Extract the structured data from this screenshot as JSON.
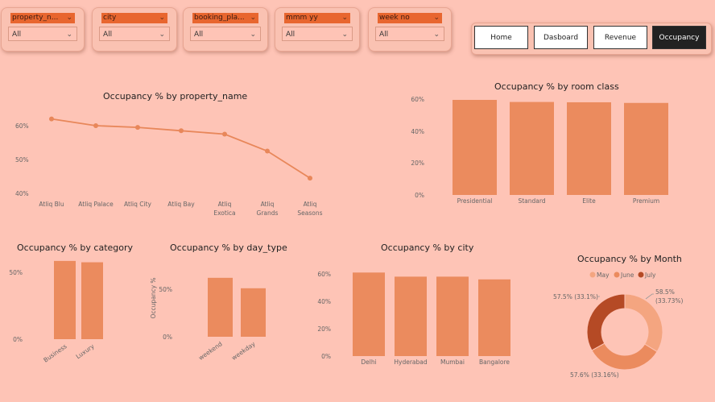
{
  "slicers": [
    {
      "label": "property_n...",
      "value": "All"
    },
    {
      "label": "city",
      "value": "All"
    },
    {
      "label": "booking_pla...",
      "value": "All"
    },
    {
      "label": "mmm yy",
      "value": "All"
    },
    {
      "label": "week no",
      "value": "All"
    }
  ],
  "nav": {
    "home": "Home",
    "dashboard": "Dasboard",
    "revenue": "Revenue",
    "occupancy": "Occupancy"
  },
  "colors": {
    "background": "#FEC4B6",
    "bar": "#EB8B5E",
    "line": "#E8875A",
    "slicer_header": "#E8662F",
    "may": "#F4A580",
    "june": "#EB8B5E",
    "july": "#B54A25"
  },
  "chart_data": [
    {
      "type": "line",
      "title": "Occupancy % by property_name",
      "categories": [
        "Atliq Blu",
        "Atliq Palace",
        "Atliq City",
        "Atliq Bay",
        "Atliq Exotica",
        "Atliq Grands",
        "Atliq Seasons"
      ],
      "values": [
        62,
        60,
        59.5,
        58.5,
        57.5,
        52.5,
        44.5
      ],
      "yticks": [
        "40%",
        "50%",
        "60%"
      ],
      "ylim": [
        40,
        65
      ]
    },
    {
      "type": "bar",
      "title": "Occupancy % by room class",
      "categories": [
        "Presidential",
        "Standard",
        "Elite",
        "Premium"
      ],
      "values": [
        59.5,
        58.2,
        58,
        57.6
      ],
      "yticks": [
        "0%",
        "20%",
        "40%",
        "60%"
      ],
      "ylim": [
        0,
        60
      ]
    },
    {
      "type": "bar",
      "title": "Occupancy % by category",
      "categories": [
        "Business",
        "Luxury"
      ],
      "values": [
        58.5,
        57.5
      ],
      "yticks": [
        "0%",
        "50%"
      ],
      "ylim": [
        0,
        50
      ]
    },
    {
      "type": "bar",
      "title": "Occupancy % by day_type",
      "ylabel": "Occupancy %",
      "categories": [
        "weekend",
        "weekday"
      ],
      "values": [
        62,
        51
      ],
      "yticks": [
        "0%",
        "50%"
      ],
      "ylim": [
        0,
        50
      ]
    },
    {
      "type": "bar",
      "title": "Occupancy % by city",
      "categories": [
        "Delhi",
        "Hyderabad",
        "Mumbai",
        "Bangalore"
      ],
      "values": [
        61,
        58,
        58,
        56
      ],
      "yticks": [
        "0%",
        "20%",
        "40%",
        "60%"
      ],
      "ylim": [
        0,
        60
      ]
    },
    {
      "type": "pie",
      "title": "Occupancy % by Month",
      "legend": [
        "May",
        "June",
        "July"
      ],
      "slices": [
        {
          "name": "May",
          "value": 33.73,
          "label": "58.5%\n(33.73%)"
        },
        {
          "name": "June",
          "value": 33.16,
          "label": "57.6% (33.16%)"
        },
        {
          "name": "July",
          "value": 33.1,
          "label": "57.5% (33.1%)"
        }
      ]
    }
  ]
}
